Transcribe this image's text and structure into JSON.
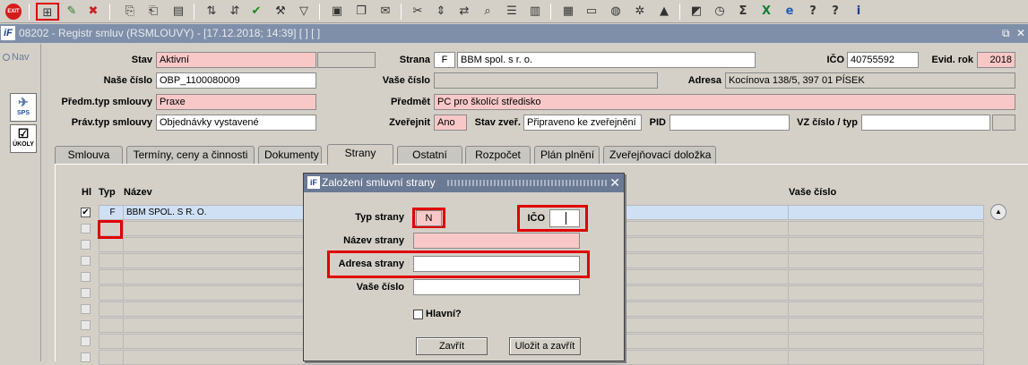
{
  "toolbar": {
    "exit_label": "EXIT",
    "icons": [
      "exit-icon",
      "new-record-icon",
      "edit-icon",
      "delete-icon",
      "copy-icon",
      "paste-icon",
      "print-icon",
      "sort-asc-icon",
      "sort-desc-icon",
      "confirm-icon",
      "wrench-icon",
      "filter-icon",
      "printer-icon",
      "page-icon",
      "mail-icon",
      "cut-icon",
      "arrows-icon",
      "transfer-icon",
      "zoom-icon",
      "list-icon",
      "columns-icon",
      "calculator-icon",
      "save-icon",
      "globe-icon",
      "settings-icon",
      "warning-icon",
      "chart-icon",
      "clock-icon",
      "sum-icon",
      "excel-icon",
      "explorer-icon",
      "help-icon",
      "info-icon"
    ]
  },
  "window": {
    "title": "08202 - Registr smluv (RSMLOUVY) - [17.12.2018; 14:39]  [ ]  [ ]",
    "logo": "iF"
  },
  "nav": {
    "label": "Nav",
    "sps_label": "SPS",
    "ukoly_label": "ÚKOLY"
  },
  "form": {
    "stav_label": "Stav",
    "stav_value": "Aktivní",
    "strana_label": "Strana",
    "strana_code": "F",
    "strana_value": "BBM spol. s r. o.",
    "ico_label": "IČO",
    "ico_value": "40755592",
    "evid_rok_label": "Evid. rok",
    "evid_rok_value": "2018",
    "nase_cislo_label": "Naše číslo",
    "nase_cislo_value": "OBP_1100080009",
    "vase_cislo_label": "Vaše číslo",
    "vase_cislo_value": "",
    "adresa_label": "Adresa",
    "adresa_value": "Kocínova 138/5, 397 01 PÍSEK",
    "predm_typ_label": "Předm.typ smlouvy",
    "predm_typ_value": "Praxe",
    "predmet_label": "Předmět",
    "predmet_value": "PC pro školící středisko",
    "prav_typ_label": "Práv.typ smlouvy",
    "prav_typ_value": "Objednávky vystavené",
    "zverejnit_label": "Zveřejnit",
    "zverejnit_value": "Ano",
    "stav_zver_label": "Stav zveř.",
    "stav_zver_value": "Připraveno ke zveřejnění",
    "pid_label": "PID",
    "pid_value": "",
    "vz_label": "VZ číslo / typ",
    "vz_value": ""
  },
  "tabs": [
    "Smlouva",
    "Termíny, ceny a činnosti",
    "Dokumenty",
    "Strany",
    "Ostatní",
    "Rozpočet",
    "Plán plnění",
    "Zveřejňovací doložka"
  ],
  "active_tab": "Strany",
  "grid": {
    "headers": {
      "hl": "Hl",
      "typ": "Typ",
      "nazev": "Název",
      "vase_cislo": "Vaše číslo"
    },
    "rows": [
      {
        "hl": true,
        "typ": "F",
        "nazev": "BBM SPOL. S R. O.",
        "vase_cislo": ""
      }
    ],
    "checkmark": "✔"
  },
  "dialog": {
    "title": "Založení smluvní strany",
    "close_glyph": "✕",
    "typ_strany_label": "Typ strany",
    "typ_strany_value": "N",
    "ico_label": "IČO",
    "ico_value": "",
    "nazev_strany_label": "Název strany",
    "nazev_strany_value": "",
    "adresa_strany_label": "Adresa strany",
    "adresa_strany_value": "",
    "vase_cislo_label": "Vaše číslo",
    "vase_cislo_value": "",
    "hlavni_label": "Hlavní?",
    "zavrit_label": "Zavřít",
    "ulozit_label": "Uložit a zavřít"
  },
  "colors": {
    "highlight": "#e00000",
    "required": "#f8c8c8",
    "titlebar": "#7f8fa9",
    "selected_row": "#cfe0f5"
  }
}
